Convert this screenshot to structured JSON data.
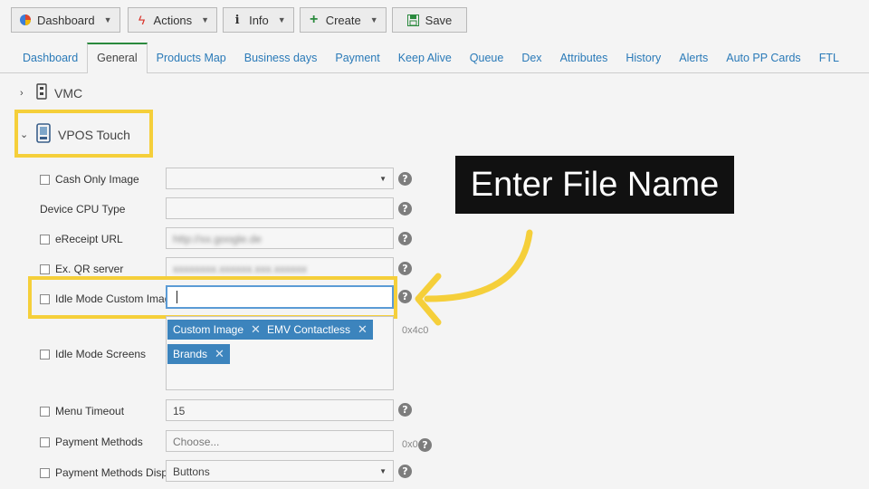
{
  "toolbar": {
    "dashboard": "Dashboard",
    "actions": "Actions",
    "info": "Info",
    "create": "Create",
    "save": "Save"
  },
  "tabs": [
    "Dashboard",
    "General",
    "Products Map",
    "Business days",
    "Payment",
    "Keep Alive",
    "Queue",
    "Dex",
    "Attributes",
    "History",
    "Alerts",
    "Auto PP Cards",
    "FTL"
  ],
  "tree": {
    "vmc": "VMC",
    "vpos": "VPOS Touch"
  },
  "form": {
    "cash_only_image": "Cash Only Image",
    "device_cpu_type": "Device CPU Type",
    "ereceipt_url": "eReceipt URL",
    "ereceipt_value": "http://xx.google.de",
    "ex_qr_server": "Ex. QR server",
    "ex_qr_value": "xxxxxxxx.xxxxxx.xxx.xxxxxx",
    "idle_mode_custom_image": "Idle Mode Custom Image",
    "idle_mode_screens": "Idle Mode Screens",
    "tags": [
      "Custom Image",
      "EMV Contactless",
      "Brands"
    ],
    "screens_hex": "0x4c0",
    "menu_timeout": "Menu Timeout",
    "menu_timeout_value": "15",
    "payment_methods": "Payment Methods",
    "payment_methods_placeholder": "Choose...",
    "payment_hex": "0x0",
    "payment_methods_display": "Payment Methods Display",
    "payment_methods_display_value": "Buttons"
  },
  "callout": "Enter File Name",
  "colors": {
    "highlight": "#f5cf3a",
    "tab_link": "#2a7ab8",
    "tag_bg": "#3c84bd"
  }
}
